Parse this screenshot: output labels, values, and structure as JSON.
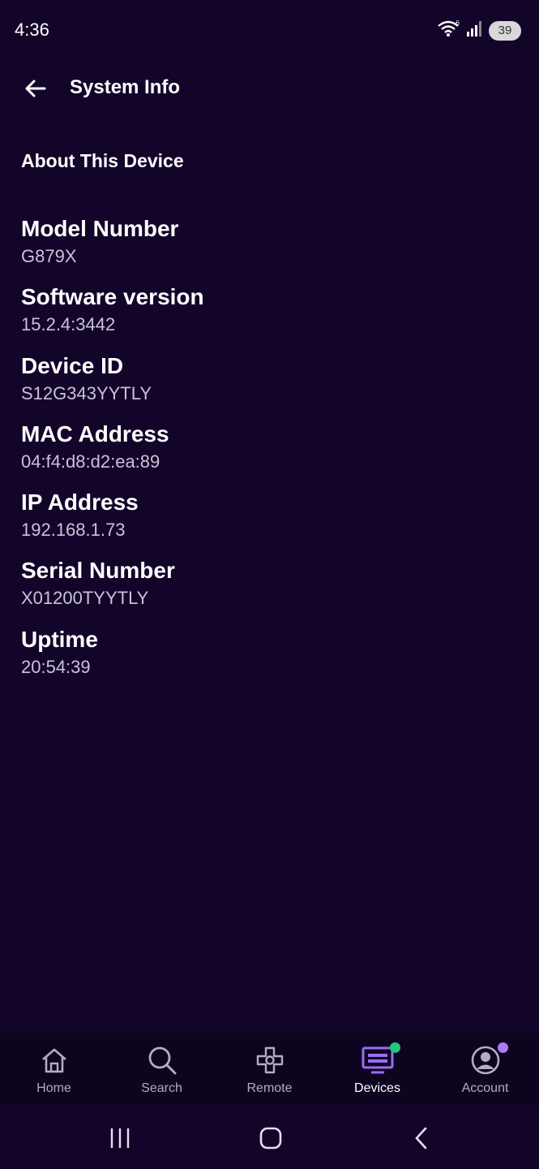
{
  "status_bar": {
    "time": "4:36",
    "battery": "39",
    "icons": [
      "wifi-icon",
      "signal-icon",
      "battery-icon"
    ]
  },
  "app_bar": {
    "title": "System Info"
  },
  "section": {
    "title": "About This Device"
  },
  "info": [
    {
      "label": "Model Number",
      "value": "G879X"
    },
    {
      "label": "Software version",
      "value": "15.2.4:3442"
    },
    {
      "label": "Device ID",
      "value": "S12G343YYTLY"
    },
    {
      "label": "MAC Address",
      "value": "04:f4:d8:d2:ea:89"
    },
    {
      "label": "IP Address",
      "value": "192.168.1.73"
    },
    {
      "label": "Serial Number",
      "value": "X01200TYYTLY"
    },
    {
      "label": "Uptime",
      "value": "20:54:39"
    }
  ],
  "bottom_nav": {
    "items": [
      {
        "label": "Home",
        "icon": "home-icon"
      },
      {
        "label": "Search",
        "icon": "search-icon"
      },
      {
        "label": "Remote",
        "icon": "remote-icon"
      },
      {
        "label": "Devices",
        "icon": "devices-icon",
        "active": true,
        "badge_color": "#1fc87a"
      },
      {
        "label": "Account",
        "icon": "account-icon",
        "badge_color": "#a97cf5"
      }
    ]
  },
  "colors": {
    "background": "#13052a",
    "accent": "#9a6cf0",
    "active_icon": "#9a6cf0"
  }
}
